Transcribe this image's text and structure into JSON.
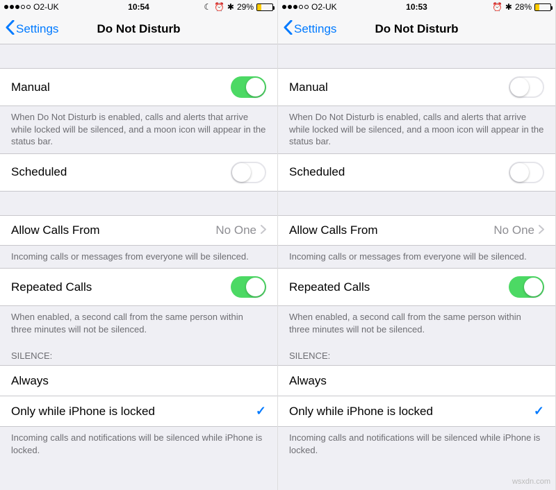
{
  "left": {
    "status": {
      "carrier": "O2-UK",
      "time": "10:54",
      "moon": "☾",
      "alarm": "⏰",
      "bt": "✱",
      "battery_pct": "29%",
      "battery_fill": 29
    },
    "nav": {
      "back": "Settings",
      "title": "Do Not Disturb"
    },
    "manual": {
      "label": "Manual",
      "on": true
    },
    "manual_footer": "When Do Not Disturb is enabled, calls and alerts that arrive while locked will be silenced, and a moon icon will appear in the status bar.",
    "scheduled": {
      "label": "Scheduled",
      "on": false
    },
    "allow": {
      "label": "Allow Calls From",
      "value": "No One"
    },
    "allow_footer": "Incoming calls or messages from everyone will be silenced.",
    "repeated": {
      "label": "Repeated Calls",
      "on": true
    },
    "repeated_footer": "When enabled, a second call from the same person within three minutes will not be silenced.",
    "silence_header": "SILENCE:",
    "silence_always": "Always",
    "silence_locked": "Only while iPhone is locked",
    "silence_footer": "Incoming calls and notifications will be silenced while iPhone is locked."
  },
  "right": {
    "status": {
      "carrier": "O2-UK",
      "time": "10:53",
      "alarm": "⏰",
      "bt": "✱",
      "battery_pct": "28%",
      "battery_fill": 28
    },
    "nav": {
      "back": "Settings",
      "title": "Do Not Disturb"
    },
    "manual": {
      "label": "Manual",
      "on": false
    },
    "manual_footer": "When Do Not Disturb is enabled, calls and alerts that arrive while locked will be silenced, and a moon icon will appear in the status bar.",
    "scheduled": {
      "label": "Scheduled",
      "on": false
    },
    "allow": {
      "label": "Allow Calls From",
      "value": "No One"
    },
    "allow_footer": "Incoming calls or messages from everyone will be silenced.",
    "repeated": {
      "label": "Repeated Calls",
      "on": true
    },
    "repeated_footer": "When enabled, a second call from the same person within three minutes will not be silenced.",
    "silence_header": "SILENCE:",
    "silence_always": "Always",
    "silence_locked": "Only while iPhone is locked",
    "silence_footer": "Incoming calls and notifications will be silenced while iPhone is locked."
  },
  "watermark": "wsxdn.com"
}
